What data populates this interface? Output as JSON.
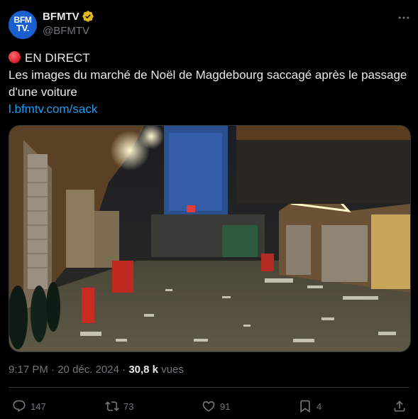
{
  "author": {
    "avatar_text_line1": "BFM",
    "avatar_text_line2": "TV.",
    "display_name": "BFMTV",
    "handle": "@BFMTV",
    "verified_badge": "gold"
  },
  "tweet": {
    "live_label": "EN DIRECT",
    "text_line1": "Les images du marché de Noël de Magdebourg saccagé après le passage",
    "text_line2": "d'une voiture",
    "link": "l.bfmtv.com/sack"
  },
  "meta": {
    "time": "9:17 PM",
    "separator": "·",
    "date": "20 déc. 2024",
    "views_count": "30,8 k",
    "views_label": "vues"
  },
  "actions": {
    "replies": "147",
    "retweets": "73",
    "likes": "91",
    "bookmarks": "4"
  },
  "icons": {
    "more": "more-dots-icon",
    "reply": "reply-icon",
    "retweet": "retweet-icon",
    "like": "heart-icon",
    "bookmark": "bookmark-icon",
    "share": "share-icon",
    "verified": "verified-badge-icon",
    "live": "red-circle-icon"
  },
  "colors": {
    "background": "#000000",
    "text": "#e7e9ea",
    "muted": "#71767b",
    "link": "#1d9bf0",
    "verified_gold": "#e2b719",
    "live_red": "#d41f2a"
  }
}
